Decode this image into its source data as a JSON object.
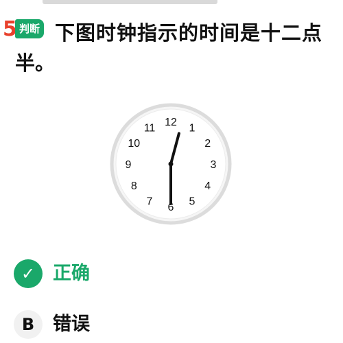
{
  "question": {
    "number": "5",
    "badge": "判断",
    "text_line1": "下图时钟指示的时间是十二点",
    "text_line2": "半。"
  },
  "clock": {
    "numerals": [
      "12",
      "1",
      "2",
      "3",
      "4",
      "5",
      "6",
      "7",
      "8",
      "9",
      "10",
      "11"
    ],
    "hour": 12,
    "minute": 30
  },
  "options": [
    {
      "marker": "✓",
      "label": "正确",
      "selected": true
    },
    {
      "marker": "B",
      "label": "错误",
      "selected": false
    }
  ],
  "colors": {
    "accent": "#1aa86a",
    "number": "#e8412c"
  }
}
